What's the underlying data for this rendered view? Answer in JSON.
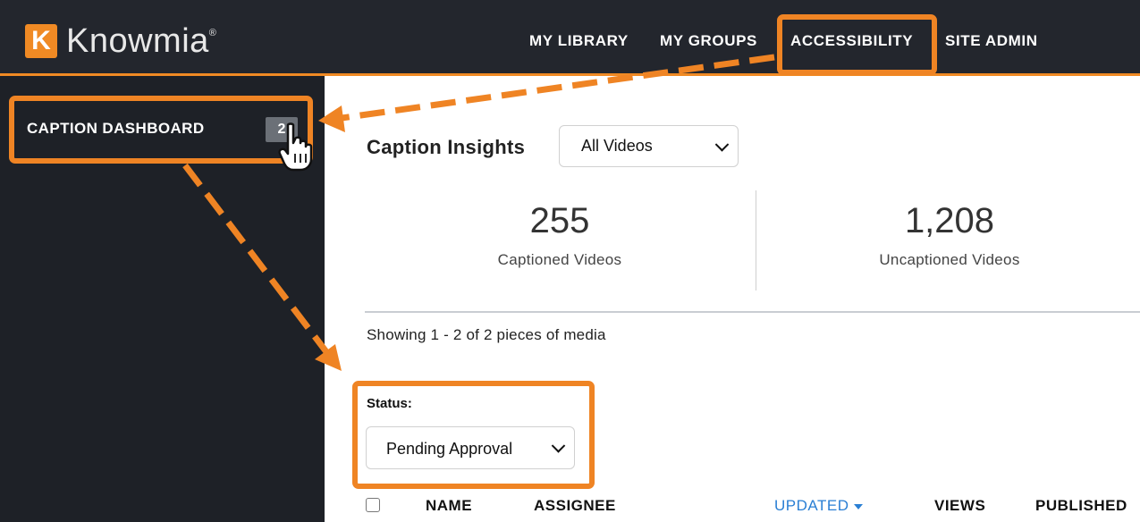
{
  "header": {
    "logo_letter": "K",
    "brand": "Knowmia",
    "brand_mark": "®",
    "nav": [
      "MY LIBRARY",
      "MY GROUPS",
      "ACCESSIBILITY",
      "SITE ADMIN"
    ]
  },
  "sidebar": {
    "item_label": "CAPTION DASHBOARD",
    "item_count": "2"
  },
  "insights": {
    "title": "Caption Insights",
    "filter_value": "All Videos",
    "captioned_count": "255",
    "captioned_label": "Captioned Videos",
    "uncaptioned_count": "1,208",
    "uncaptioned_label": "Uncaptioned Videos"
  },
  "media": {
    "showing_text": "Showing 1 - 2 of 2 pieces of media",
    "status_label": "Status:",
    "status_value": "Pending Approval"
  },
  "table": {
    "columns": [
      "NAME",
      "ASSIGNEE",
      "UPDATED",
      "VIEWS",
      "PUBLISHED"
    ],
    "sorted_column": "UPDATED"
  },
  "colors": {
    "accent": "#ef8424",
    "topbar": "#23262d",
    "sidebar": "#1e2127",
    "sort_link": "#2a7fd4"
  },
  "icons": [
    "hand-cursor-icon",
    "chevron-down-icon",
    "sort-caret-icon"
  ]
}
